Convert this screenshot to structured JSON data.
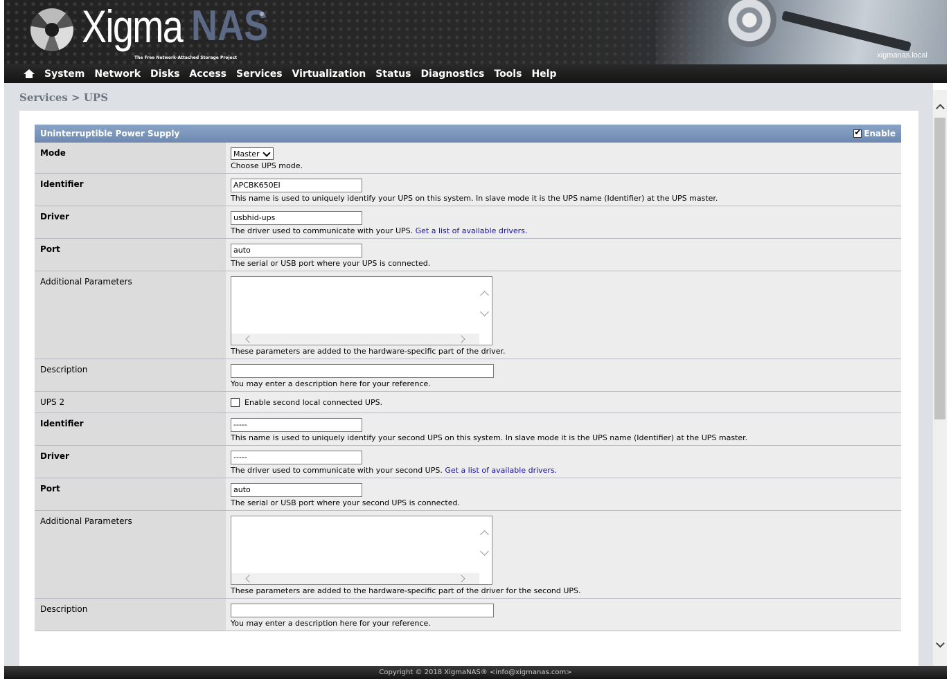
{
  "header": {
    "logo_text": "Xigma",
    "logo_text2": "NAS",
    "tagline": "The Free Network-Attached Storage Project",
    "registered": "®",
    "hostname": "xigmanas.local"
  },
  "nav": {
    "items": [
      "System",
      "Network",
      "Disks",
      "Access",
      "Services",
      "Virtualization",
      "Status",
      "Diagnostics",
      "Tools",
      "Help"
    ]
  },
  "breadcrumb": "Services > UPS",
  "form": {
    "title": "Uninterruptible Power Supply",
    "enable_label": "Enable",
    "enable_checked": true,
    "mode": {
      "label": "Mode",
      "value": "Master",
      "hint": "Choose UPS mode."
    },
    "identifier": {
      "label": "Identifier",
      "value": "APCBK650EI",
      "hint": "This name is used to uniquely identify your UPS on this system. In slave mode it is the UPS name (Identifier) at the UPS master."
    },
    "driver": {
      "label": "Driver",
      "value": "usbhid-ups",
      "hint": "The driver used to communicate with your UPS.",
      "link": "Get a list of available drivers."
    },
    "port": {
      "label": "Port",
      "value": "auto",
      "hint": "The serial or USB port where your UPS is connected."
    },
    "params": {
      "label": "Additional Parameters",
      "hint": "These parameters are added to the hardware-specific part of the driver."
    },
    "description": {
      "label": "Description",
      "value": "",
      "hint": "You may enter a description here for your reference."
    },
    "ups2": {
      "label": "UPS 2",
      "checkbox_label": "Enable second local connected UPS.",
      "checked": false
    },
    "identifier2": {
      "label": "Identifier",
      "value": "-----",
      "hint": "This name is used to uniquely identify your second UPS on this system. In slave mode it is the UPS name (Identifier) at the UPS master."
    },
    "driver2": {
      "label": "Driver",
      "value": "-----",
      "hint": "The driver used to communicate with your second UPS.",
      "link": "Get a list of available drivers."
    },
    "port2": {
      "label": "Port",
      "value": "auto",
      "hint": "The serial or USB port where your second UPS is connected."
    },
    "params2": {
      "label": "Additional Parameters",
      "hint": "These parameters are added to the hardware-specific part of the driver for the second UPS."
    },
    "description2": {
      "label": "Description",
      "value": "",
      "hint": "You may enter a description here for your reference."
    }
  },
  "footer": "Copyright © 2018 XigmaNAS® <info@xigmanas.com>"
}
